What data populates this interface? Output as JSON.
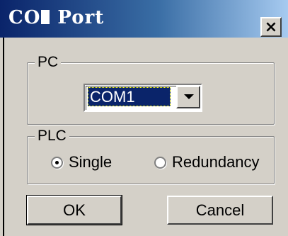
{
  "window": {
    "title_prefix": "CO",
    "title_suffix": "Port",
    "close_label": "×"
  },
  "pc_group": {
    "label": "PC",
    "port_value": "COM1"
  },
  "plc_group": {
    "label": "PLC",
    "options": [
      {
        "label": "Single",
        "selected": true
      },
      {
        "label": "Redundancy",
        "selected": false
      }
    ]
  },
  "buttons": {
    "ok_label": "OK",
    "cancel_label": "Cancel"
  },
  "colors": {
    "titlebar_dark": "#0a246a",
    "titlebar_light": "#a6caf0",
    "face": "#d4d0c8"
  }
}
